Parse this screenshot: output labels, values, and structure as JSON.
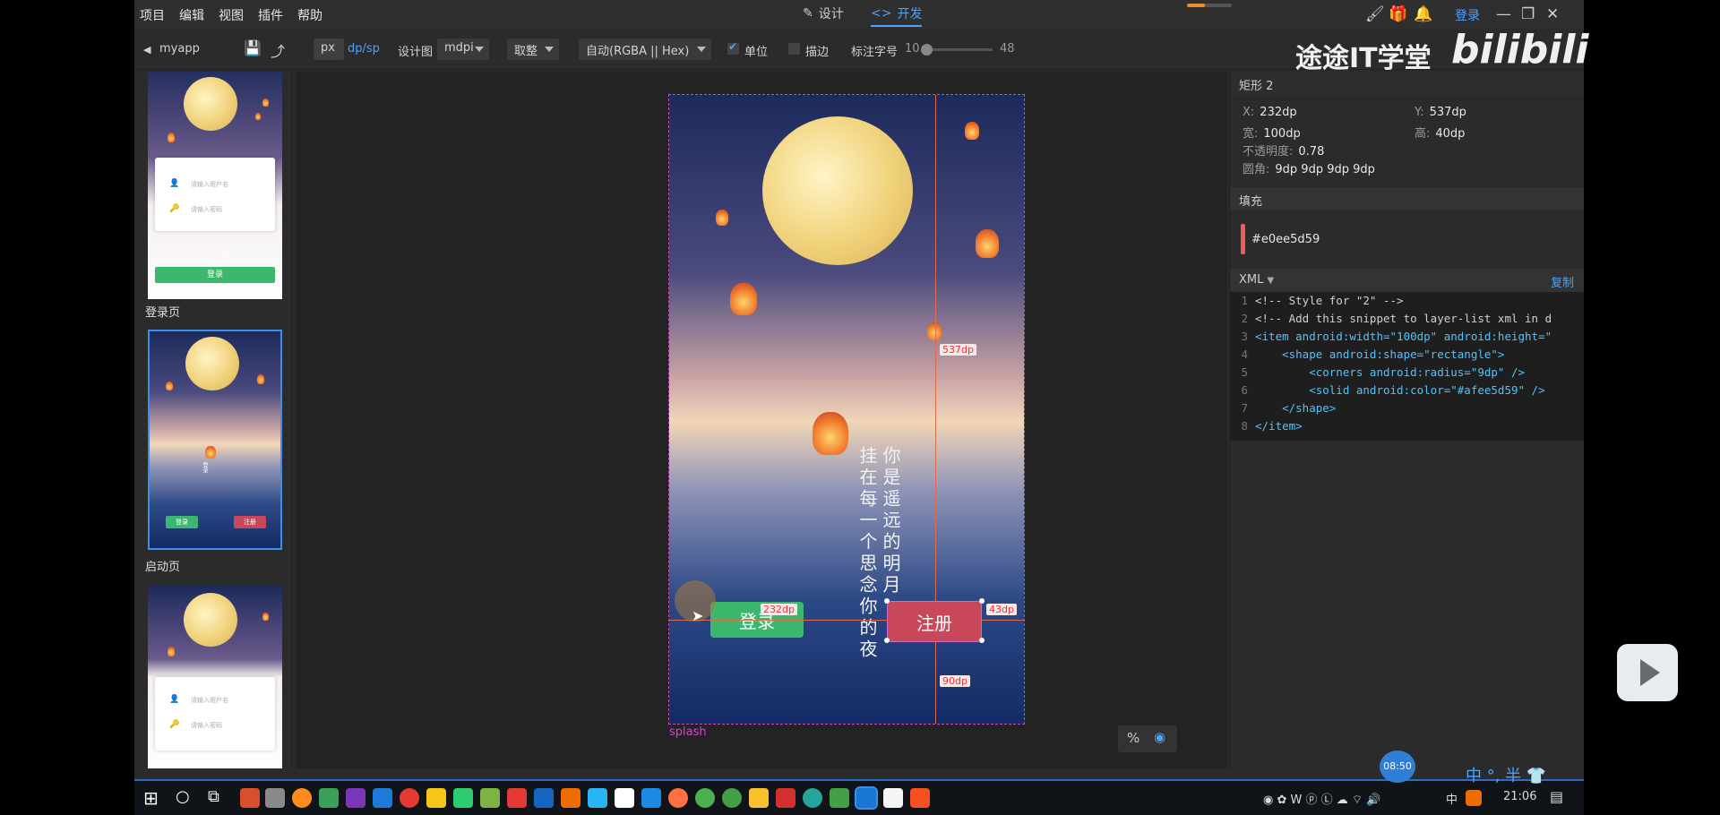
{
  "menu": [
    "项目",
    "编辑",
    "视图",
    "插件",
    "帮助"
  ],
  "modes": {
    "design": "设计",
    "dev": "开发"
  },
  "login_link": "登录",
  "toolbar": {
    "project": "myapp",
    "unit_px": "px",
    "unit_dp": "dp/sp",
    "design_label": "设计图",
    "density": "mdpi",
    "rounding": "取整",
    "color_format": "自动(RGBA || Hex)",
    "unit_label": "单位",
    "stroke_label": "描边",
    "font_label": "标注字号",
    "font_min": "10",
    "font_max": "48"
  },
  "pages": [
    {
      "label": "登录页",
      "user_ph": "请输入用户名",
      "pwd_ph": "请输入密码",
      "btn": "登录"
    },
    {
      "label": "启动页",
      "btn_login": "登录",
      "btn_register": "注册"
    },
    {
      "user_ph": "请输入用户名",
      "pwd_ph": "请输入密码"
    }
  ],
  "canvas": {
    "artboard_label": "splash",
    "poem_col1": "你是遥远的明月",
    "poem_col2": "挂在每一个思念你的夜",
    "btn_login": "登录",
    "btn_register": "注册",
    "measures": {
      "top": "537dp",
      "left": "232dp",
      "right": "43dp",
      "bottom": "90dp"
    }
  },
  "inspector": {
    "title": "矩形 2",
    "x_label": "X:",
    "x": "232dp",
    "y_label": "Y:",
    "y": "537dp",
    "w_label": "宽:",
    "w": "100dp",
    "h_label": "高:",
    "h": "40dp",
    "opacity_label": "不透明度:",
    "opacity": "0.78",
    "radius_label": "圆角:",
    "radius": "9dp 9dp 9dp 9dp",
    "fill_head": "填充",
    "fill_value": "#e0ee5d59",
    "fill_color": "#ee5d59",
    "xml_head": "XML",
    "copy": "复制"
  },
  "code_lines": [
    "<!-- Style for \"2\" -->",
    "<!-- Add this snippet to layer-list xml in d",
    "<item android:width=\"100dp\" android:height=\"",
    "    <shape android:shape=\"rectangle\">",
    "        <corners android:radius=\"9dp\" />",
    "        <solid android:color=\"#afee5d59\" />",
    "    </shape>",
    "</item>"
  ],
  "watermark": {
    "text": "途途IT学堂",
    "logo": "bilibili"
  },
  "taskbar": {
    "clock": "21:06",
    "ime": "中",
    "timer": "08:50",
    "ime_toolbar": "中 °, 半"
  },
  "colors": {
    "accent": "#4aa3ff",
    "login_btn": "#3cb86e",
    "register_btn": "#c8485a",
    "guide": "#e06a4a"
  }
}
